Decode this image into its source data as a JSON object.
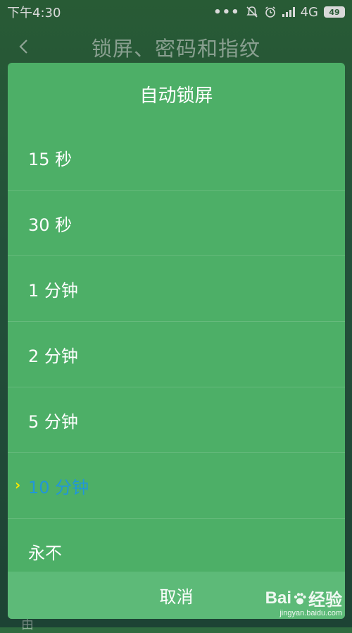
{
  "status_bar": {
    "time": "下午4:30",
    "dots": "•••",
    "network": "4G",
    "battery": "49"
  },
  "header": {
    "title": "锁屏、密码和指纹"
  },
  "dialog": {
    "title": "自动锁屏",
    "options": [
      {
        "label": "15 秒",
        "selected": false
      },
      {
        "label": "30 秒",
        "selected": false
      },
      {
        "label": "1 分钟",
        "selected": false
      },
      {
        "label": "2 分钟",
        "selected": false
      },
      {
        "label": "5 分钟",
        "selected": false
      },
      {
        "label": "10 分钟",
        "selected": true
      },
      {
        "label": "永不",
        "selected": false
      }
    ],
    "cancel_label": "取消"
  },
  "watermark": {
    "url": "jingyan.baidu.com"
  },
  "colors": {
    "dialog_bg": "#4daf67",
    "selected_text": "#2196d9",
    "check_mark": "#f3e800"
  }
}
